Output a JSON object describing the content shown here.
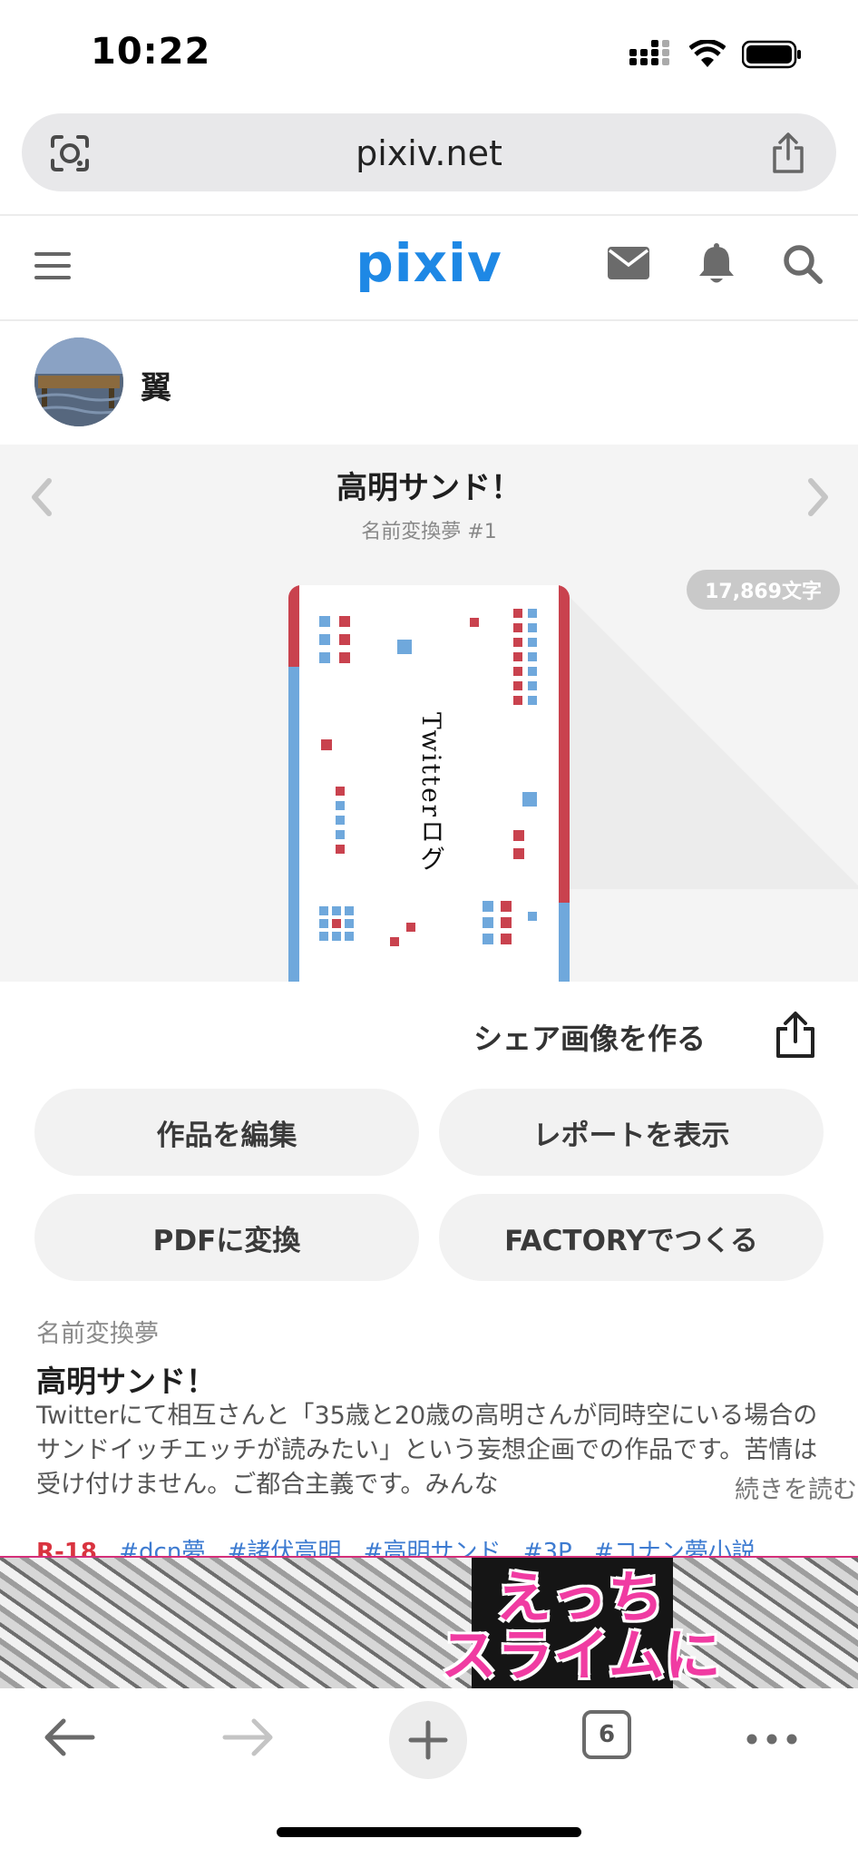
{
  "status_bar": {
    "time": "10:22"
  },
  "browser": {
    "url": "pixiv.net"
  },
  "header": {
    "logo": "pixiv"
  },
  "author": {
    "name": "翼"
  },
  "work": {
    "title": "高明サンド！",
    "series_label": "名前変換夢 #1",
    "char_count": "17,869文字",
    "cover_title": "Twitterログ"
  },
  "actions": {
    "share_image": "シェア画像を作る",
    "edit": "作品を編集",
    "report": "レポートを表示",
    "pdf": "PDFに変換",
    "factory": "FACTORYでつくる"
  },
  "caption": {
    "series": "名前変換夢",
    "title": "高明サンド！",
    "description": "Twitterにて相互さんと「35歳と20歳の高明さんが同時空にいる場合のサンドイッチエッチが読みたい」という妄想企画での作品です。苦情は受け付けません。ご都合主義です。みんな",
    "read_more": "続きを読む"
  },
  "tags": [
    "R-18",
    "#dcn夢",
    "#諸伏高明",
    "#高明サンド",
    "#3P",
    "#コナン夢小説"
  ],
  "ad": {
    "text_line1": "えっち",
    "text_line2": "スライムに"
  },
  "toolbar": {
    "tab_count": "6"
  },
  "colors": {
    "brand": "#1e88e5",
    "accent_red": "#c9424e",
    "accent_blue": "#6fa8dc",
    "tag_link": "#3d7bd1",
    "r18": "#d9333f"
  }
}
